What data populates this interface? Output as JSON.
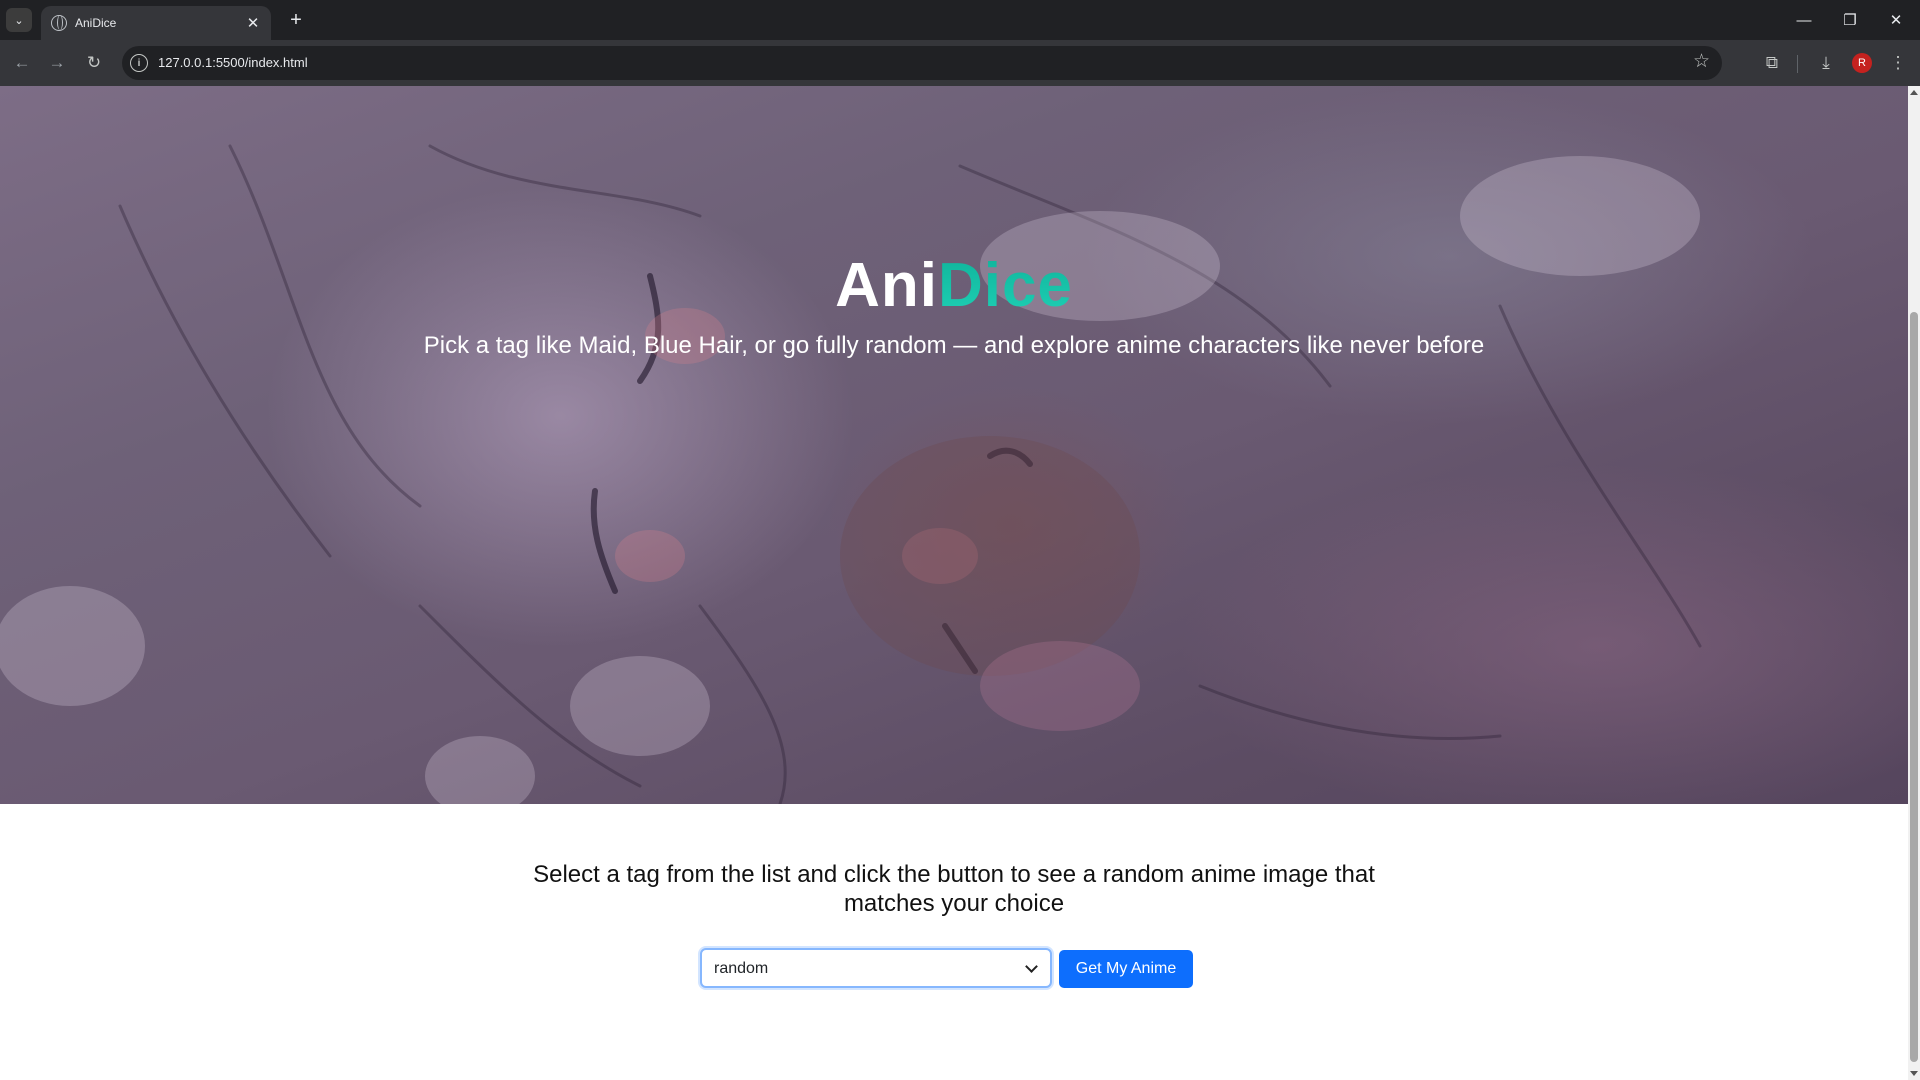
{
  "browser": {
    "tab_title": "AniDice",
    "url": "127.0.0.1:5500/index.html",
    "profile_initial": "R",
    "icons": [
      "tab-list-icon",
      "globe-icon",
      "close-icon",
      "plus-icon",
      "minimize-icon",
      "restore-icon",
      "back-arrow-icon",
      "forward-arrow-icon",
      "reload-icon",
      "info-icon",
      "star-icon",
      "extensions-icon",
      "download-icon",
      "kebab-menu-icon"
    ]
  },
  "hero": {
    "title_main": "Ani",
    "title_accent": "Dice",
    "subtitle": "Pick a tag like Maid, Blue Hair, or go fully random — and explore anime characters like never before",
    "accent_color": "#19c2a6"
  },
  "main": {
    "instruction": "Select a tag from the list and click the button to see a random anime image that matches your choice",
    "select_value": "random",
    "button_label": "Get My Anime",
    "button_color": "#0d6efd"
  }
}
